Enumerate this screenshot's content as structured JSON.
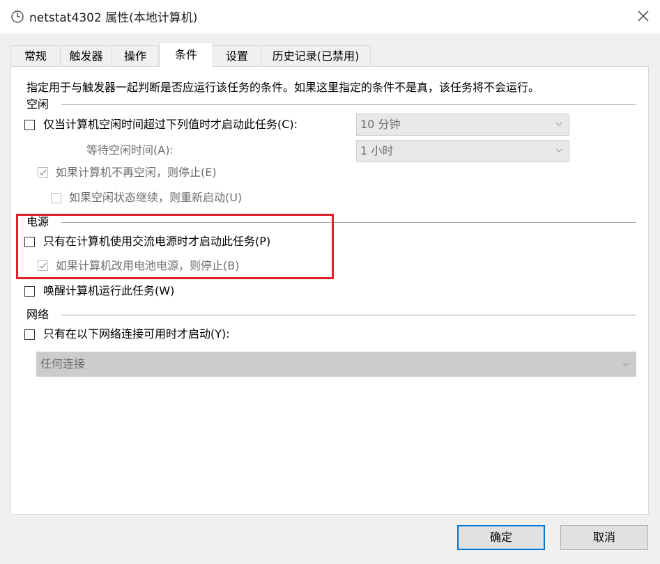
{
  "window": {
    "title": "netstat4302 属性(本地计算机)"
  },
  "tabs": [
    "常规",
    "触发器",
    "操作",
    "条件",
    "设置",
    "历史记录(已禁用)"
  ],
  "description": "指定用于与触发器一起判断是否应运行该任务的条件。如果这里指定的条件不是真，该任务将不会运行。",
  "idle": {
    "group_label": "空闲",
    "start_if_idle_label": "仅当计算机空闲时间超过下列值时才启动此任务(C):",
    "idle_duration_value": "10 分钟",
    "wait_idle_label": "等待空闲时间(A):",
    "wait_idle_value": "1 小时",
    "stop_if_not_idle_label": "如果计算机不再空闲，则停止(E)",
    "restart_if_idle_resumes_label": "如果空闲状态继续，则重新启动(U)"
  },
  "power": {
    "group_label": "电源",
    "ac_only_label": "只有在计算机使用交流电源时才启动此任务(P)",
    "stop_on_battery_label": "如果计算机改用电池电源，则停止(B)",
    "wake_label": "唤醒计算机运行此任务(W)"
  },
  "network": {
    "group_label": "网络",
    "network_only_label": "只有在以下网络连接可用时才启动(Y):",
    "connection_value": "任何连接"
  },
  "buttons": {
    "ok": "确定",
    "cancel": "取消"
  },
  "colors": {
    "highlight": "#e0202a",
    "primary_border": "#0078d7"
  }
}
